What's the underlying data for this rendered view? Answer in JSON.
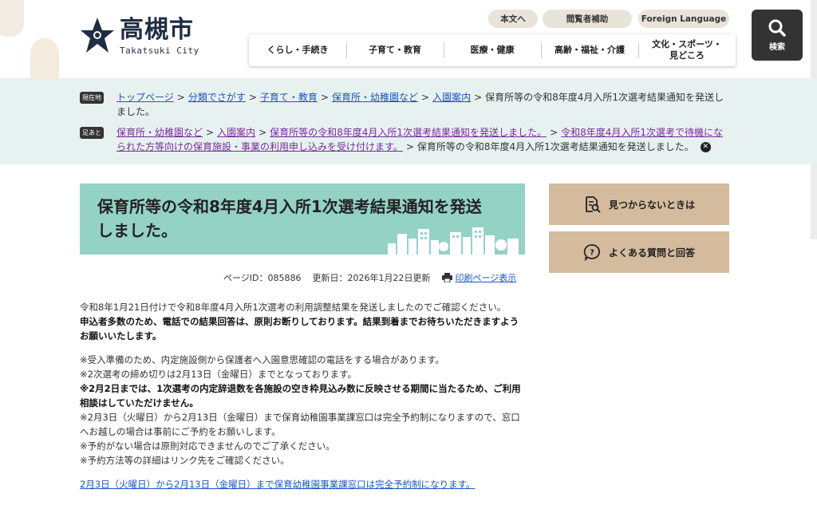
{
  "header": {
    "logo_jp": "高槻市",
    "logo_en": "Takatsuki City",
    "utility": {
      "honbun": "本文へ",
      "etsuran": "閲覧者補助",
      "foreign": "Foreign Language"
    },
    "search_label": "検索",
    "nav": [
      "くらし・手続き",
      "子育て・教育",
      "医療・健康",
      "高齢・福祉・介護",
      "文化・スポーツ・\n見どころ"
    ]
  },
  "breadcrumb": {
    "current_tag": "現在地",
    "current": [
      "トップページ",
      "分類でさがす",
      "子育て・教育",
      "保育所・幼稚園など",
      "入園案内"
    ],
    "current_last": "保育所等の令和8年度4月入所1次選考結果通知を発送しました。",
    "history_tag": "足あと",
    "history": [
      "保育所・幼稚園など",
      "入園案内",
      "保育所等の令和8年度4月入所1次選考結果通知を発送しました。",
      "令和8年度4月入所1次選考で待機になられた方等向けの保育施設・事業の利用申し込みを受け付けます。"
    ],
    "history_last": "保育所等の令和8年度4月入所1次選考結果通知を発送しました。"
  },
  "page": {
    "title": "保育所等の令和8年度4月入所1次選考結果通知を発送しました。",
    "page_id": "ページID：085886",
    "updated": "更新日：2026年1月22日更新",
    "print_link": "印刷ページ表示"
  },
  "content": {
    "p1": "令和8年1月21日付けで令和8年度4月入所1次選考の利用調整結果を発送しましたのでご確認ください。",
    "p2": "申込者多数のため、電話での結果回答は、原則お断りしております。結果到着までお待ちいただきますようお願いいたします。",
    "n1": "※受入準備のため、内定施設側から保護者へ入園意思確認の電話をする場合があります。",
    "n2": "※2次選考の締め切りは2月13日（金曜日）までとなっております。",
    "n3": "※2月2日までは、1次選考の内定辞退数を各施設の空き枠見込み数に反映させる期間に当たるため、ご利用相談はしていただけません。",
    "n4": "※2月3日（火曜日）から2月13日（金曜日）まで保育幼稚園事業課窓口は完全予約制になりますので、窓口へお越しの場合は事前にご予約をお願いします。",
    "n5": "※予約がない場合は原則対応できませんのでご了承ください。",
    "n6": "※予約方法等の詳細はリンク先をご確認ください。",
    "link": "2月3日（火曜日）から2月13日（金曜日）まで保育幼稚園事業課窓口は完全予約制になります。"
  },
  "sidebar": {
    "notfound": "見つからないときは",
    "faq": "よくある質問と回答"
  },
  "colors": {
    "banner": "#94d2c6",
    "crumb_bg": "#e7f2f0",
    "side_btn": "#d4bb9d",
    "link": "#1a55c6",
    "visited": "#7a2c9c"
  }
}
